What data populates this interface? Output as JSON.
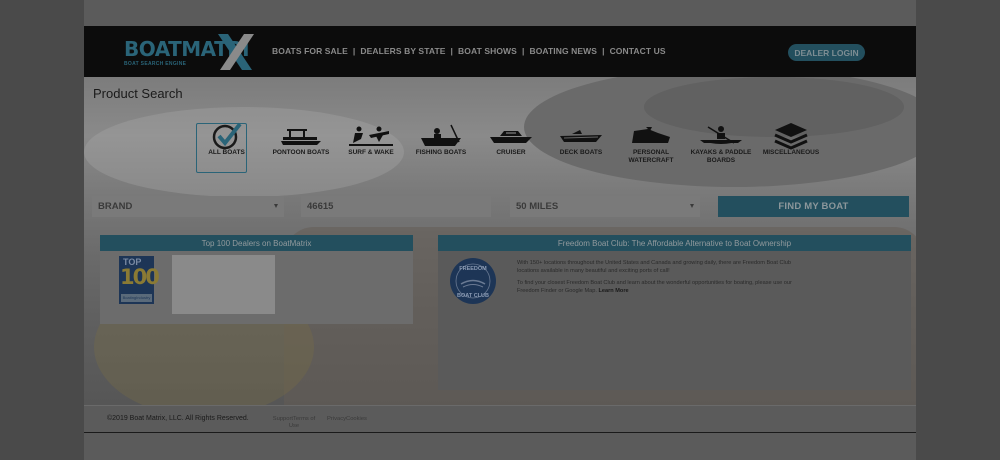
{
  "header": {
    "logo_text": "BOATMATRI",
    "logo_tagline": "BOAT SEARCH ENGINE",
    "nav": [
      {
        "label": "BOATS FOR SALE"
      },
      {
        "label": "DEALERS BY STATE"
      },
      {
        "label": "BOAT SHOWS"
      },
      {
        "label": "BOATING NEWS"
      },
      {
        "label": "CONTACT US"
      }
    ],
    "nav_separator": "|",
    "dealer_login": "DEALER LOGIN"
  },
  "main": {
    "title": "Product Search",
    "categories": [
      {
        "label": "ALL BOATS",
        "icon": "checkmark-icon",
        "active": true
      },
      {
        "label": "PONTOON BOATS",
        "icon": "pontoon-boat-icon"
      },
      {
        "label": "SURF & WAKE",
        "icon": "wakeboard-icon"
      },
      {
        "label": "FISHING BOATS",
        "icon": "fishing-boat-icon"
      },
      {
        "label": "CRUISER",
        "icon": "cruiser-icon"
      },
      {
        "label": "DECK BOATS",
        "icon": "deck-boat-icon"
      },
      {
        "label": "PERSONAL WATERCRAFT",
        "icon": "jet-ski-icon"
      },
      {
        "label": "KAYAKS & PADDLE BOARDS",
        "icon": "kayak-icon"
      },
      {
        "label": "MISCELLANEOUS",
        "icon": "layers-icon"
      }
    ],
    "search": {
      "brand": "BRAND",
      "zip": "46615",
      "radius": "50 MILES",
      "submit": "FIND MY BOAT"
    },
    "dealers_panel": {
      "heading": "Top 100 Dealers on BoatMatrix",
      "badge_top": "TOP",
      "badge_number": "100",
      "badge_caption": "BoatingIndustry"
    },
    "fbc_panel": {
      "heading": "Freedom Boat Club: The Affordable Alternative to Boat Ownership",
      "logo_line1": "FREEDOM",
      "logo_line2": "BOAT CLUB",
      "para1": "With 150+ locations throughout the United States and Canada and growing daily, there are Freedom Boat Club locations available in many beautiful and exciting ports of call!",
      "para2": "To find your closest Freedom Boat Club and learn about the wonderful opportunities for boating, please use our Freedom Finder or Google Map.",
      "learn_more": "Learn More"
    }
  },
  "footer": {
    "copyright": "©2019 Boat Matrix, LLC. All Rights Reserved.",
    "links": [
      {
        "label": "SupportTerms of Use"
      },
      {
        "label": "PrivacyCookies"
      }
    ]
  },
  "colors": {
    "teal": "#234f5e",
    "header_bg": "#0c0c0c",
    "overlay": "#5b5b5b"
  }
}
